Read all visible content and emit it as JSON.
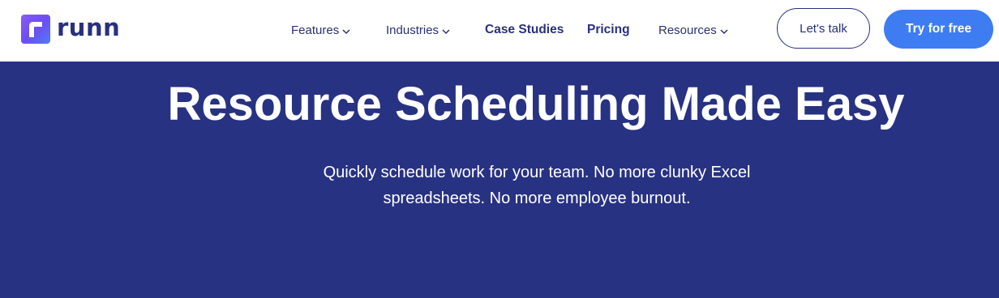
{
  "brand": {
    "name": "runn",
    "colors": {
      "primary_navy": "#283282",
      "accent_blue": "#3e7cf2",
      "logo_purple": "#8a5cf6"
    }
  },
  "nav": {
    "features": "Features",
    "industries": "Industries",
    "case_studies": "Case Studies",
    "pricing": "Pricing",
    "resources": "Resources"
  },
  "actions": {
    "talk": "Let's talk",
    "try": "Try for free"
  },
  "hero": {
    "title": "Resource Scheduling Made Easy",
    "subtitle": "Quickly schedule work for your team. No more clunky Excel spreadsheets. No more employee burnout."
  },
  "icons": {
    "dropdown": "chevron-down-icon",
    "logo": "runn-logo-icon"
  }
}
